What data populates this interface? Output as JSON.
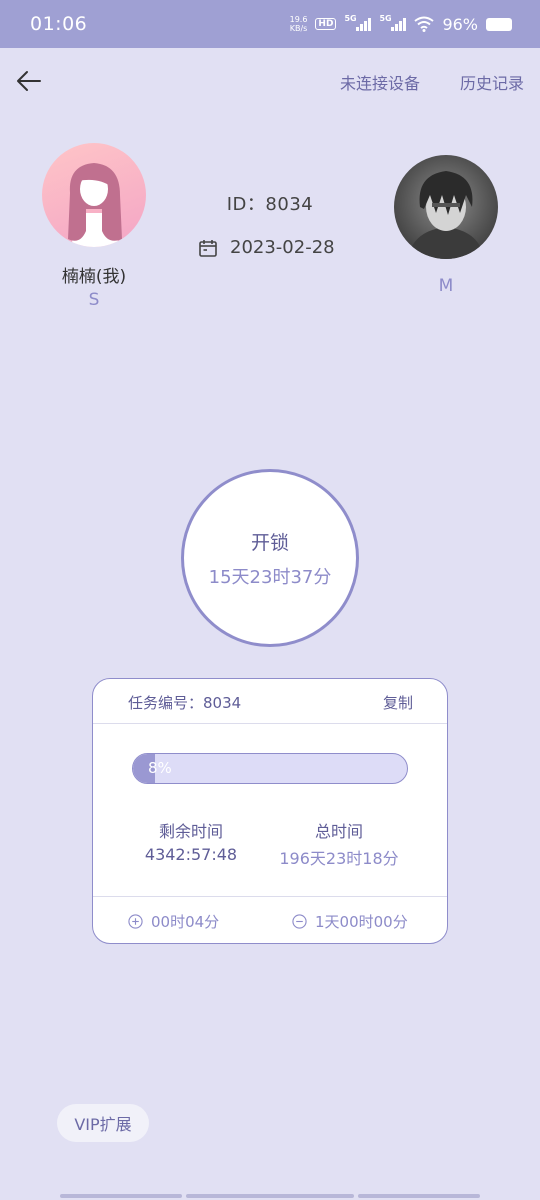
{
  "status_bar": {
    "time": "01:06",
    "net_speed_value": "19.6",
    "net_speed_unit": "KB/s",
    "hd_badge": "HD",
    "signal1": "5G",
    "signal2": "5G",
    "battery_percent": "96%"
  },
  "nav": {
    "device_status": "未连接设备",
    "history": "历史记录"
  },
  "profile": {
    "me_name": "楠楠(我)",
    "me_role": "S",
    "partner_role": "M",
    "id_text": "ID：8034",
    "date": "2023-02-28"
  },
  "unlock": {
    "label": "开锁",
    "remaining": "15天23时37分"
  },
  "task": {
    "number_text": "任务编号：8034",
    "copy_label": "复制",
    "progress": 0.08,
    "progress_text": "8%",
    "remaining_label": "剩余时间",
    "remaining_value": "4342:57:48",
    "total_label": "总时间",
    "total_value": "196天23时18分",
    "add_label": "00时04分",
    "subtract_label": "1天00时00分"
  },
  "vip": {
    "label": "VIP扩展"
  },
  "colors": {
    "background": "#e1e0f3",
    "status_bar": "#9fa0d3",
    "accent": "#8f8dcb",
    "progress_fill": "#9a98d2"
  }
}
